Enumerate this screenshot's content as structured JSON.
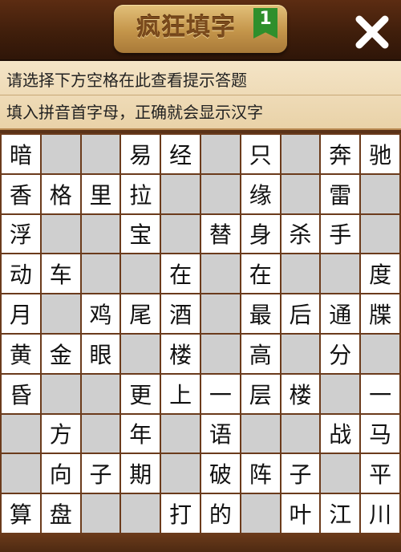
{
  "header": {
    "title": "疯狂填字",
    "level": "1",
    "close_label": "✕"
  },
  "hints": {
    "line1": "请选择下方空格在此查看提示答题",
    "line2": "填入拼音首字母，正确就会显示汉字"
  },
  "grid": {
    "rows": [
      [
        "暗",
        "",
        "",
        "易",
        "经",
        "",
        "只",
        "",
        "奔",
        "驰"
      ],
      [
        "香",
        "格",
        "里",
        "拉",
        "",
        "",
        "缘",
        "",
        "雷",
        ""
      ],
      [
        "浮",
        "",
        "",
        "宝",
        "",
        "替",
        "身",
        "杀",
        "手",
        ""
      ],
      [
        "动",
        "车",
        "",
        "",
        "在",
        "",
        "在",
        "",
        "",
        "度"
      ],
      [
        "月",
        "",
        "鸡",
        "尾",
        "酒",
        "",
        "最",
        "后",
        "通",
        "牒"
      ],
      [
        "黄",
        "金",
        "眼",
        "",
        "楼",
        "",
        "高",
        "",
        "分",
        ""
      ],
      [
        "昏",
        "",
        "",
        "更",
        "上",
        "一",
        "层",
        "楼",
        "",
        "一"
      ],
      [
        "",
        "方",
        "",
        "年",
        "",
        "语",
        "",
        "",
        "战",
        "马"
      ],
      [
        "",
        "向",
        "子",
        "期",
        "",
        "破",
        "阵",
        "子",
        "",
        "平"
      ],
      [
        "算",
        "盘",
        "",
        "",
        "打",
        "的",
        "",
        "叶",
        "江",
        "川"
      ]
    ]
  },
  "colors": {
    "blank_cell": "#cfcfcf",
    "filled_cell": "#ffffff",
    "grid_line": "#6b3b1c",
    "level_badge": "#2f8f2c"
  }
}
